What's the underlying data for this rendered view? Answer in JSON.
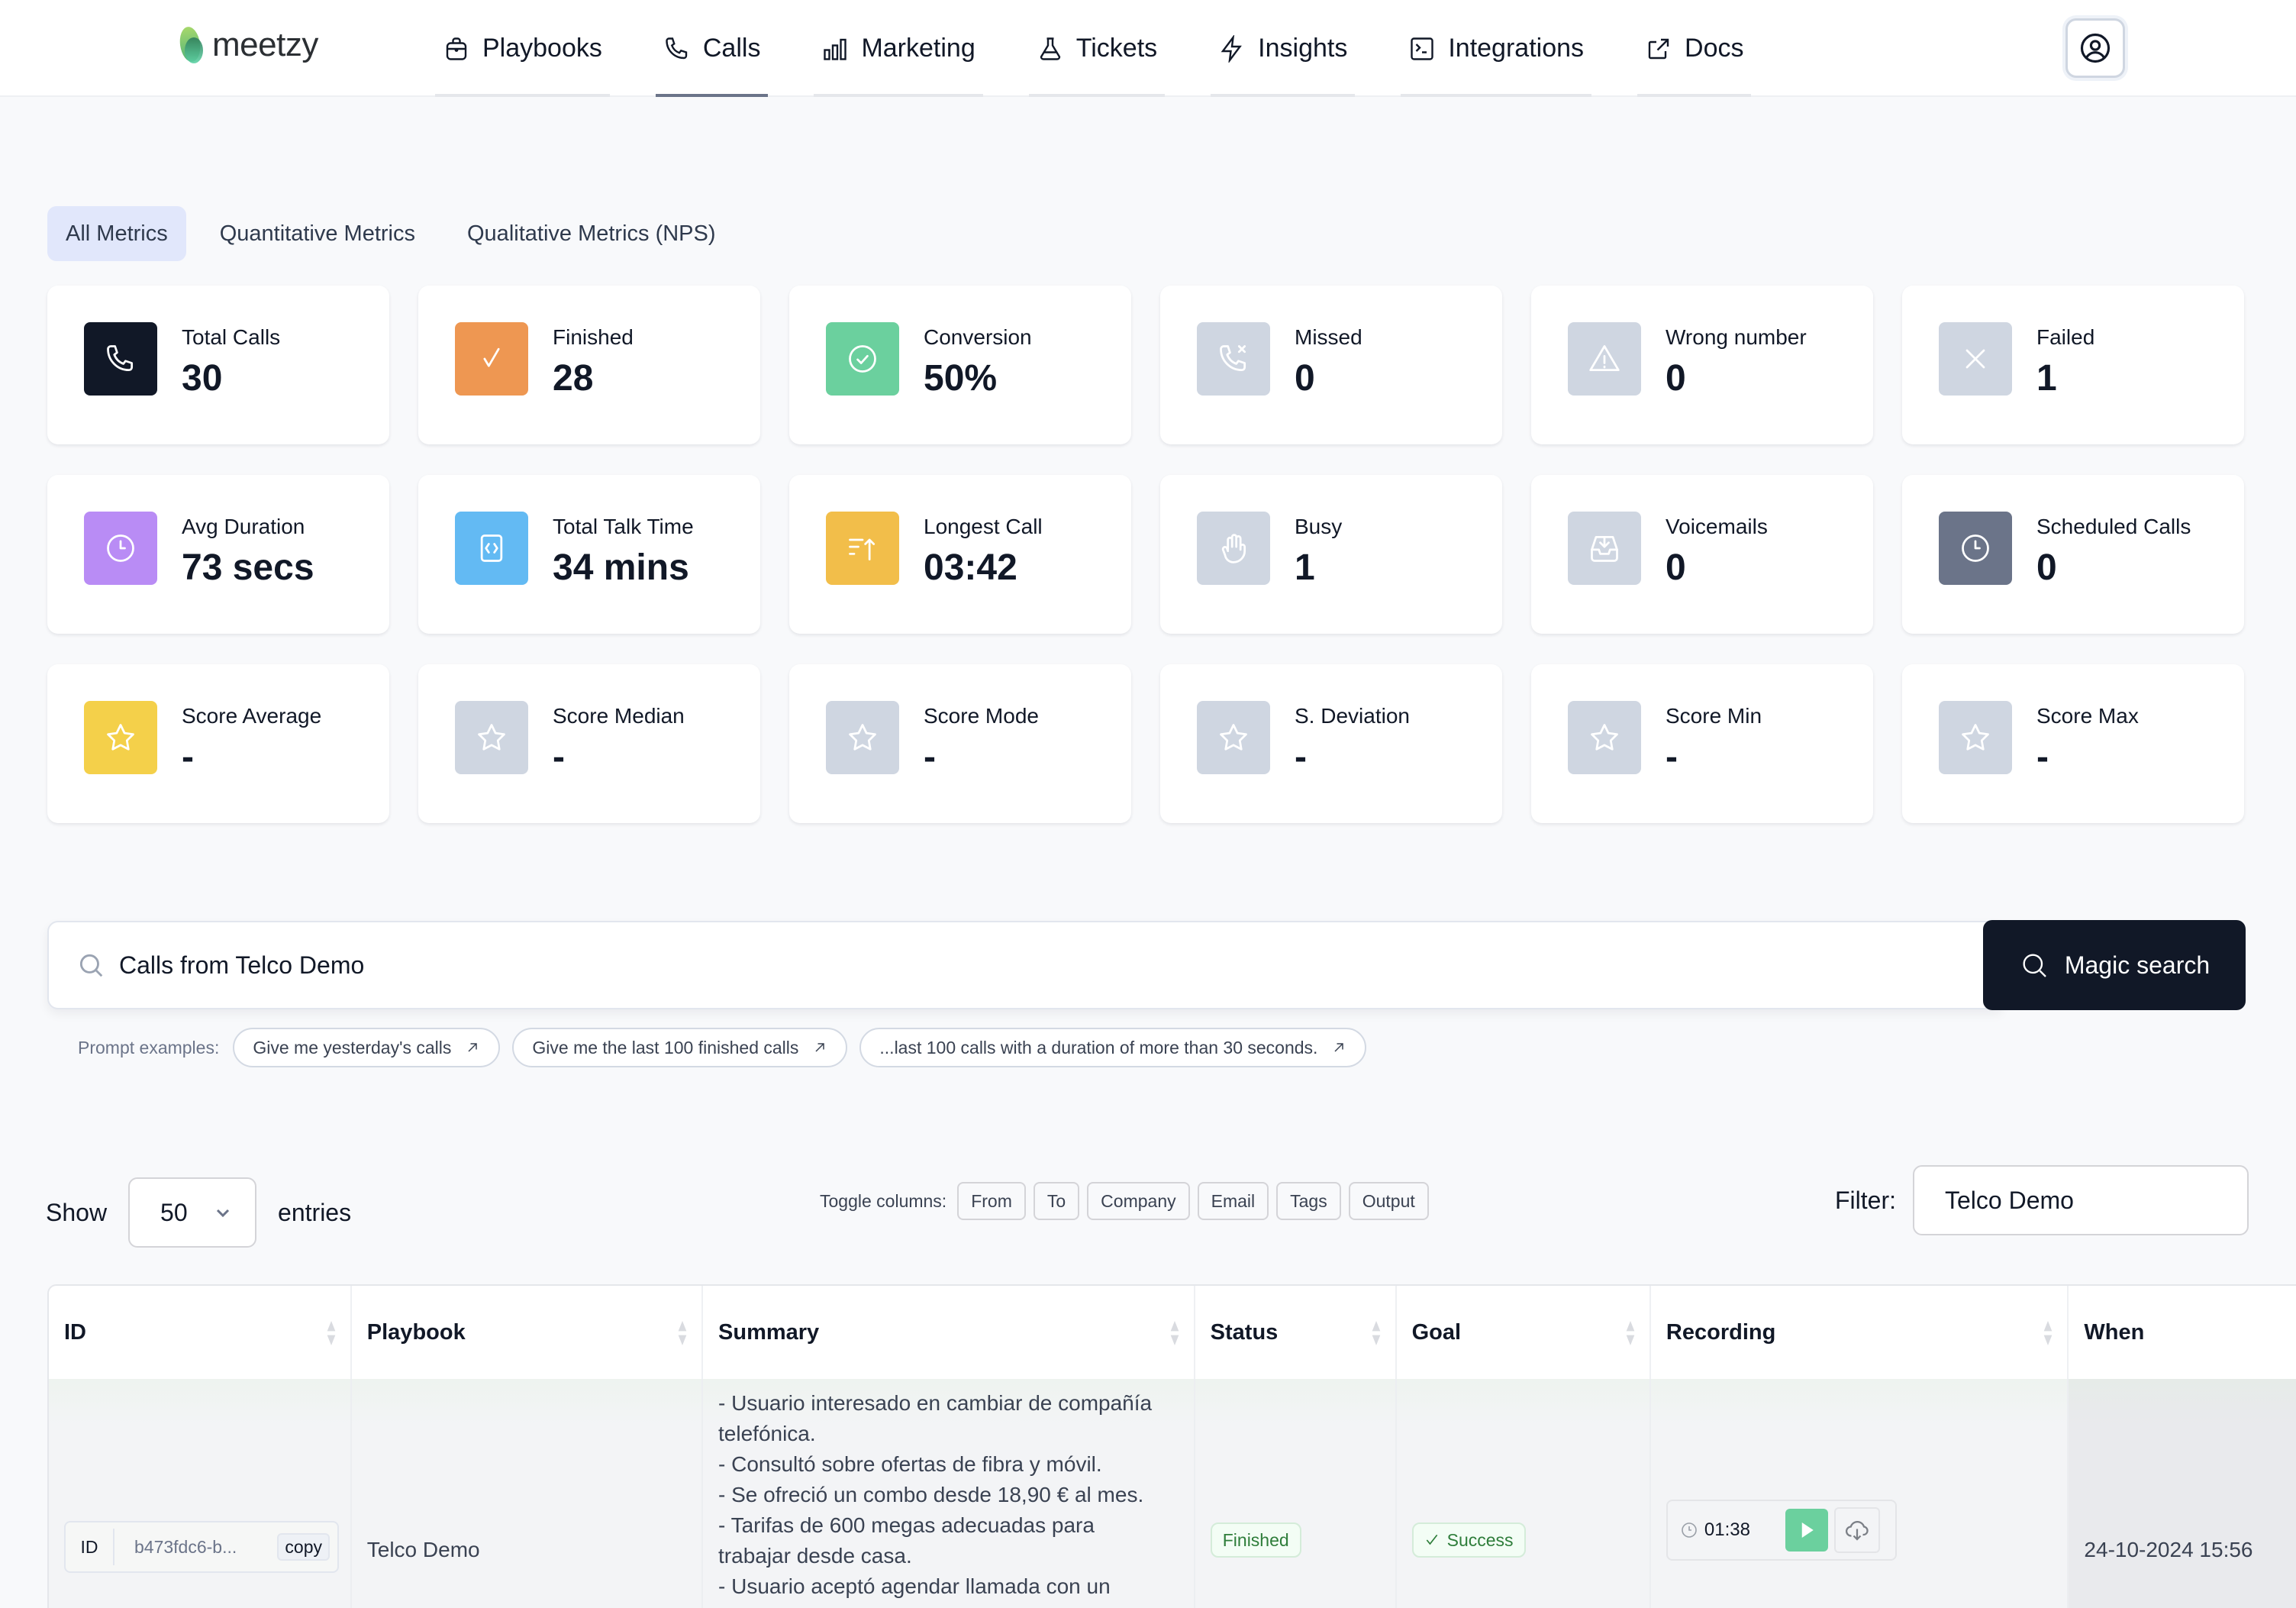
{
  "brand": {
    "name": "meetzy"
  },
  "nav": {
    "items": [
      {
        "label": "Playbooks",
        "icon": "briefcase-icon",
        "active": false
      },
      {
        "label": "Calls",
        "icon": "phone-icon",
        "active": true
      },
      {
        "label": "Marketing",
        "icon": "bar-chart-icon",
        "active": false
      },
      {
        "label": "Tickets",
        "icon": "flask-icon",
        "active": false
      },
      {
        "label": "Insights",
        "icon": "lightning-icon",
        "active": false
      },
      {
        "label": "Integrations",
        "icon": "terminal-icon",
        "active": false
      },
      {
        "label": "Docs",
        "icon": "external-link-icon",
        "active": false
      }
    ],
    "profile_icon": "user-circle-icon"
  },
  "tabs": [
    {
      "label": "All Metrics",
      "active": true
    },
    {
      "label": "Quantitative Metrics",
      "active": false
    },
    {
      "label": "Qualitative Metrics (NPS)",
      "active": false
    }
  ],
  "metrics": [
    {
      "label": "Total Calls",
      "value": "30",
      "icon": "phone-icon",
      "color": "#111827"
    },
    {
      "label": "Finished",
      "value": "28",
      "icon": "check-icon",
      "color": "#ee9752"
    },
    {
      "label": "Conversion",
      "value": "50%",
      "icon": "check-circle-icon",
      "color": "#6bd09e"
    },
    {
      "label": "Missed",
      "value": "0",
      "icon": "phone-missed-icon",
      "color": "#cfd6e1"
    },
    {
      "label": "Wrong number",
      "value": "0",
      "icon": "warning-icon",
      "color": "#cfd6e1"
    },
    {
      "label": "Failed",
      "value": "1",
      "icon": "x-icon",
      "color": "#cfd6e1"
    },
    {
      "label": "Avg Duration",
      "value": "73 secs",
      "icon": "clock-icon",
      "color": "#b98cf5"
    },
    {
      "label": "Total Talk Time",
      "value": "34 mins",
      "icon": "code-icon",
      "color": "#63baf3"
    },
    {
      "label": "Longest Call",
      "value": "03:42",
      "icon": "sort-up-icon",
      "color": "#f2be4a"
    },
    {
      "label": "Busy",
      "value": "1",
      "icon": "hand-icon",
      "color": "#cfd6e1"
    },
    {
      "label": "Voicemails",
      "value": "0",
      "icon": "inbox-icon",
      "color": "#cfd6e1"
    },
    {
      "label": "Scheduled Calls",
      "value": "0",
      "icon": "clock-icon",
      "color": "#6b7489"
    },
    {
      "label": "Score Average",
      "value": "-",
      "icon": "star-icon",
      "color": "#f4d04a"
    },
    {
      "label": "Score Median",
      "value": "-",
      "icon": "star-icon",
      "color": "#cfd6e1"
    },
    {
      "label": "Score Mode",
      "value": "-",
      "icon": "star-icon",
      "color": "#cfd6e1"
    },
    {
      "label": "S. Deviation",
      "value": "-",
      "icon": "star-icon",
      "color": "#cfd6e1"
    },
    {
      "label": "Score Min",
      "value": "-",
      "icon": "star-icon",
      "color": "#cfd6e1"
    },
    {
      "label": "Score Max",
      "value": "-",
      "icon": "star-icon",
      "color": "#cfd6e1"
    }
  ],
  "search": {
    "value": "Calls from Telco Demo",
    "button_label": "Magic search",
    "prompts_label": "Prompt examples:",
    "prompts": [
      "Give me yesterday's calls",
      "Give me the last 100 finished calls",
      "...last 100 calls with a duration of more than 30 seconds."
    ]
  },
  "table_controls": {
    "show_label": "Show",
    "entries_value": "50",
    "entries_label": "entries",
    "toggle_label": "Toggle columns:",
    "toggle_columns": [
      "From",
      "To",
      "Company",
      "Email",
      "Tags",
      "Output"
    ],
    "filter_label": "Filter:",
    "filter_value": "Telco Demo"
  },
  "table": {
    "columns": [
      "ID",
      "Playbook",
      "Summary",
      "Status",
      "Goal",
      "Recording",
      "When"
    ],
    "rows": [
      {
        "id_label": "ID",
        "id": "b473fdc6-b...",
        "copy_label": "copy",
        "playbook": "Telco Demo",
        "summary": "- Usuario interesado en cambiar de compañía telefónica.\n- Consultó sobre ofertas de fibra y móvil.\n- Se ofreció un combo desde 18,90 € al mes.\n- Tarifas de 600 megas adecuadas para trabajar desde casa.\n- Usuario aceptó agendar llamada con un",
        "status": "Finished",
        "goal": "Success",
        "recording_duration": "01:38",
        "when": "24-10-2024 15:56"
      }
    ]
  }
}
